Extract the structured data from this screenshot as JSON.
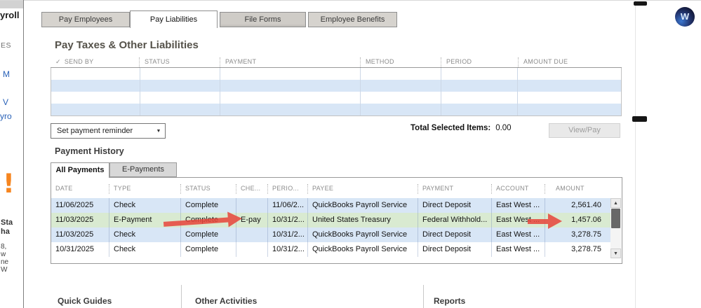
{
  "app": {
    "corner_icon_letter": "W"
  },
  "left_rail": {
    "fragments": [
      "yroll",
      "ES",
      "M",
      "V",
      "yro",
      "!",
      "Sta",
      "ha",
      "8,",
      "w",
      "ne",
      "W"
    ]
  },
  "tabs": {
    "items": [
      {
        "label": "Pay Employees",
        "active": false
      },
      {
        "label": "Pay Liabilities",
        "active": true
      },
      {
        "label": "File Forms",
        "active": false
      },
      {
        "label": "Employee Benefits",
        "active": false
      }
    ]
  },
  "liabilities": {
    "title": "Pay Taxes & Other Liabilities",
    "check_glyph": "✓",
    "columns": [
      "SEND BY",
      "STATUS",
      "PAYMENT",
      "METHOD",
      "PERIOD",
      "AMOUNT DUE"
    ],
    "reminder_button_label": "Set payment reminder",
    "total_selected_label": "Total Selected Items:",
    "total_selected_value": "0.00",
    "view_pay_label": "View/Pay"
  },
  "payment_history": {
    "title": "Payment History",
    "tabs": [
      "All Payments",
      "E-Payments"
    ],
    "columns": [
      "DATE",
      "TYPE",
      "STATUS",
      "CHE...",
      "PERIO...",
      "PAYEE",
      "PAYMENT",
      "ACCOUNT",
      "AMOUNT"
    ],
    "rows": [
      {
        "date": "11/06/2025",
        "type": "Check",
        "status": "Complete",
        "checknum": "",
        "period": "11/06/2...",
        "payee": "QuickBooks Payroll Service",
        "payment": "Direct Deposit",
        "account": "East West ...",
        "amount": "2,561.40",
        "selected": false
      },
      {
        "date": "11/03/2025",
        "type": "E-Payment",
        "status": "Complete",
        "checknum": "E-pay",
        "period": "10/31/2...",
        "payee": "United States Treasury",
        "payment": "Federal Withhold...",
        "account": "East West ...",
        "amount": "1,457.06",
        "selected": true
      },
      {
        "date": "11/03/2025",
        "type": "Check",
        "status": "Complete",
        "checknum": "",
        "period": "10/31/2...",
        "payee": "QuickBooks Payroll Service",
        "payment": "Direct Deposit",
        "account": "East West ...",
        "amount": "3,278.75",
        "selected": false
      },
      {
        "date": "10/31/2025",
        "type": "Check",
        "status": "Complete",
        "checknum": "",
        "period": "10/31/2...",
        "payee": "QuickBooks Payroll Service",
        "payment": "Direct Deposit",
        "account": "East West ...",
        "amount": "3,278.75",
        "selected": false
      }
    ]
  },
  "footer": {
    "sections": [
      "Quick Guides",
      "Other Activities",
      "Reports"
    ]
  },
  "icons": {
    "dropdown": "▼",
    "scroll_up": "▲",
    "scroll_down": "▼"
  },
  "colors": {
    "row_blue": "#d8e6f6",
    "row_selected_green": "#d9ead1",
    "annotation_red": "#e8463c",
    "tab_inactive": "#d6d3ce"
  }
}
